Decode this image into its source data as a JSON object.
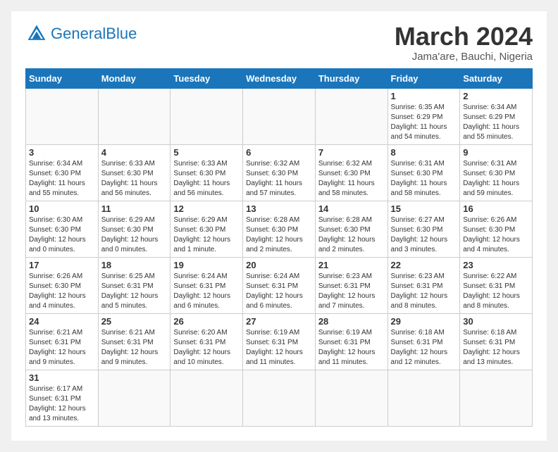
{
  "header": {
    "logo_general": "General",
    "logo_blue": "Blue",
    "month_title": "March 2024",
    "location": "Jama'are, Bauchi, Nigeria"
  },
  "days_of_week": [
    "Sunday",
    "Monday",
    "Tuesday",
    "Wednesday",
    "Thursday",
    "Friday",
    "Saturday"
  ],
  "weeks": [
    [
      {
        "num": "",
        "info": ""
      },
      {
        "num": "",
        "info": ""
      },
      {
        "num": "",
        "info": ""
      },
      {
        "num": "",
        "info": ""
      },
      {
        "num": "",
        "info": ""
      },
      {
        "num": "1",
        "info": "Sunrise: 6:35 AM\nSunset: 6:29 PM\nDaylight: 11 hours and 54 minutes."
      },
      {
        "num": "2",
        "info": "Sunrise: 6:34 AM\nSunset: 6:29 PM\nDaylight: 11 hours and 55 minutes."
      }
    ],
    [
      {
        "num": "3",
        "info": "Sunrise: 6:34 AM\nSunset: 6:30 PM\nDaylight: 11 hours and 55 minutes."
      },
      {
        "num": "4",
        "info": "Sunrise: 6:33 AM\nSunset: 6:30 PM\nDaylight: 11 hours and 56 minutes."
      },
      {
        "num": "5",
        "info": "Sunrise: 6:33 AM\nSunset: 6:30 PM\nDaylight: 11 hours and 56 minutes."
      },
      {
        "num": "6",
        "info": "Sunrise: 6:32 AM\nSunset: 6:30 PM\nDaylight: 11 hours and 57 minutes."
      },
      {
        "num": "7",
        "info": "Sunrise: 6:32 AM\nSunset: 6:30 PM\nDaylight: 11 hours and 58 minutes."
      },
      {
        "num": "8",
        "info": "Sunrise: 6:31 AM\nSunset: 6:30 PM\nDaylight: 11 hours and 58 minutes."
      },
      {
        "num": "9",
        "info": "Sunrise: 6:31 AM\nSunset: 6:30 PM\nDaylight: 11 hours and 59 minutes."
      }
    ],
    [
      {
        "num": "10",
        "info": "Sunrise: 6:30 AM\nSunset: 6:30 PM\nDaylight: 12 hours and 0 minutes."
      },
      {
        "num": "11",
        "info": "Sunrise: 6:29 AM\nSunset: 6:30 PM\nDaylight: 12 hours and 0 minutes."
      },
      {
        "num": "12",
        "info": "Sunrise: 6:29 AM\nSunset: 6:30 PM\nDaylight: 12 hours and 1 minute."
      },
      {
        "num": "13",
        "info": "Sunrise: 6:28 AM\nSunset: 6:30 PM\nDaylight: 12 hours and 2 minutes."
      },
      {
        "num": "14",
        "info": "Sunrise: 6:28 AM\nSunset: 6:30 PM\nDaylight: 12 hours and 2 minutes."
      },
      {
        "num": "15",
        "info": "Sunrise: 6:27 AM\nSunset: 6:30 PM\nDaylight: 12 hours and 3 minutes."
      },
      {
        "num": "16",
        "info": "Sunrise: 6:26 AM\nSunset: 6:30 PM\nDaylight: 12 hours and 4 minutes."
      }
    ],
    [
      {
        "num": "17",
        "info": "Sunrise: 6:26 AM\nSunset: 6:30 PM\nDaylight: 12 hours and 4 minutes."
      },
      {
        "num": "18",
        "info": "Sunrise: 6:25 AM\nSunset: 6:31 PM\nDaylight: 12 hours and 5 minutes."
      },
      {
        "num": "19",
        "info": "Sunrise: 6:24 AM\nSunset: 6:31 PM\nDaylight: 12 hours and 6 minutes."
      },
      {
        "num": "20",
        "info": "Sunrise: 6:24 AM\nSunset: 6:31 PM\nDaylight: 12 hours and 6 minutes."
      },
      {
        "num": "21",
        "info": "Sunrise: 6:23 AM\nSunset: 6:31 PM\nDaylight: 12 hours and 7 minutes."
      },
      {
        "num": "22",
        "info": "Sunrise: 6:23 AM\nSunset: 6:31 PM\nDaylight: 12 hours and 8 minutes."
      },
      {
        "num": "23",
        "info": "Sunrise: 6:22 AM\nSunset: 6:31 PM\nDaylight: 12 hours and 8 minutes."
      }
    ],
    [
      {
        "num": "24",
        "info": "Sunrise: 6:21 AM\nSunset: 6:31 PM\nDaylight: 12 hours and 9 minutes."
      },
      {
        "num": "25",
        "info": "Sunrise: 6:21 AM\nSunset: 6:31 PM\nDaylight: 12 hours and 9 minutes."
      },
      {
        "num": "26",
        "info": "Sunrise: 6:20 AM\nSunset: 6:31 PM\nDaylight: 12 hours and 10 minutes."
      },
      {
        "num": "27",
        "info": "Sunrise: 6:19 AM\nSunset: 6:31 PM\nDaylight: 12 hours and 11 minutes."
      },
      {
        "num": "28",
        "info": "Sunrise: 6:19 AM\nSunset: 6:31 PM\nDaylight: 12 hours and 11 minutes."
      },
      {
        "num": "29",
        "info": "Sunrise: 6:18 AM\nSunset: 6:31 PM\nDaylight: 12 hours and 12 minutes."
      },
      {
        "num": "30",
        "info": "Sunrise: 6:18 AM\nSunset: 6:31 PM\nDaylight: 12 hours and 13 minutes."
      }
    ],
    [
      {
        "num": "31",
        "info": "Sunrise: 6:17 AM\nSunset: 6:31 PM\nDaylight: 12 hours and 13 minutes."
      },
      {
        "num": "",
        "info": ""
      },
      {
        "num": "",
        "info": ""
      },
      {
        "num": "",
        "info": ""
      },
      {
        "num": "",
        "info": ""
      },
      {
        "num": "",
        "info": ""
      },
      {
        "num": "",
        "info": ""
      }
    ]
  ]
}
